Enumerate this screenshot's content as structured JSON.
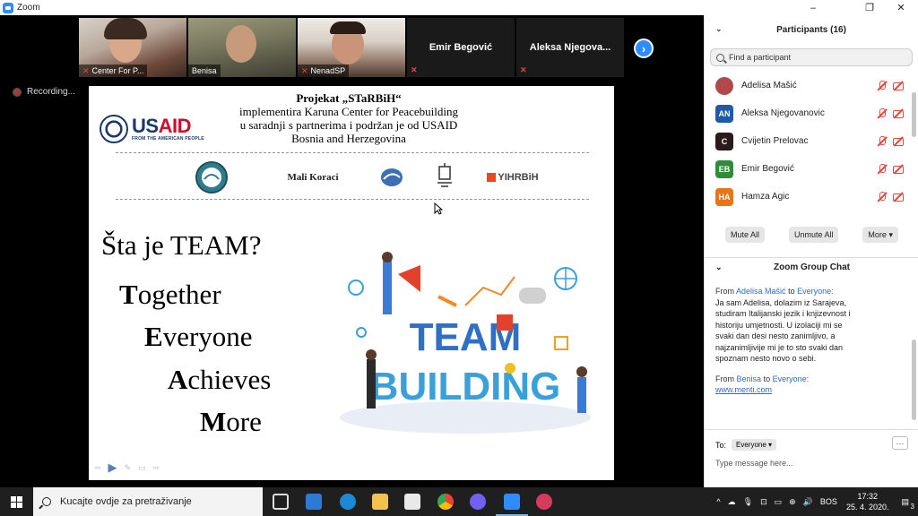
{
  "window": {
    "title": "Zoom",
    "minimize": "–",
    "restore": "❐",
    "close": "✕"
  },
  "gallery": {
    "tiles": [
      {
        "name": "Center For P..."
      },
      {
        "name": "Benisa"
      },
      {
        "name": "NenadSP"
      },
      {
        "name": "Emir Begović"
      },
      {
        "name": "Aleksa  Njegova..."
      }
    ],
    "next_icon": "›"
  },
  "recording": {
    "label": "Recording..."
  },
  "slide": {
    "header_lines": [
      "Projekat „STaRBiH“",
      "implementira Karuna Center for Peacebuilding",
      "u saradnji s partnerima i  podržan je od USAID",
      "Bosnia and Herzegovina"
    ],
    "usaid": {
      "us": "US",
      "aid": "AID",
      "tagline": "FROM THE AMERICAN PEOPLE"
    },
    "partner_logos": [
      "Mali Koraci",
      "YIHRBiH"
    ],
    "question": "Šta je TEAM?",
    "acronym": [
      {
        "initial": "T",
        "rest": "ogether"
      },
      {
        "initial": "E",
        "rest": "veryone"
      },
      {
        "initial": "A",
        "rest": "chieves"
      },
      {
        "initial": "M",
        "rest": "ore"
      }
    ],
    "illustration": {
      "line1": "TEAM",
      "line2": "BUILDING"
    }
  },
  "participants": {
    "header": "Participants (16)",
    "search_placeholder": "Find a participant",
    "list": [
      {
        "initials": "",
        "name": "Adelisa Mašić",
        "color": "#b04a4a"
      },
      {
        "initials": "AN",
        "name": "Aleksa Njegovanovic",
        "color": "#1f5aa6"
      },
      {
        "initials": "C",
        "name": "Cvijetin Prelovac",
        "color": "#2a1a1a"
      },
      {
        "initials": "EB",
        "name": "Emir Begović",
        "color": "#2f8c3a"
      },
      {
        "initials": "HA",
        "name": "Hamza Agic",
        "color": "#e8751a"
      }
    ],
    "buttons": {
      "mute_all": "Mute All",
      "unmute_all": "Unmute All",
      "more": "More"
    }
  },
  "chat": {
    "header": "Zoom Group Chat",
    "messages": [
      {
        "from_label": "From",
        "sender": "Adelisa Mašić",
        "to_label": "to",
        "recipient": "Everyone:",
        "lines": [
          "Ja sam Adelisa, dolazim iz Sarajeva,",
          "studiram Italijanski jezik i knjizevnost i",
          "historiju umjetnosti.  U izolaciji mi se",
          "svaki dan desi nesto zanimljivo, a",
          "najzanimljivije mi je to sto svaki dan",
          "spoznam nesto novo o sebi."
        ]
      },
      {
        "from_label": "From",
        "sender": "Benisa",
        "to_label": "to",
        "recipient": "Everyone:",
        "link": "www.menti.com"
      }
    ],
    "to_label": "To:",
    "to_value": "Everyone",
    "input_placeholder": "Type message here...",
    "more_icon": "···"
  },
  "taskbar": {
    "search_placeholder": "Kucajte ovdje za pretraživanje",
    "language": "BOS",
    "time": "17:32",
    "date": "25. 4. 2020.",
    "notifications": "3"
  }
}
